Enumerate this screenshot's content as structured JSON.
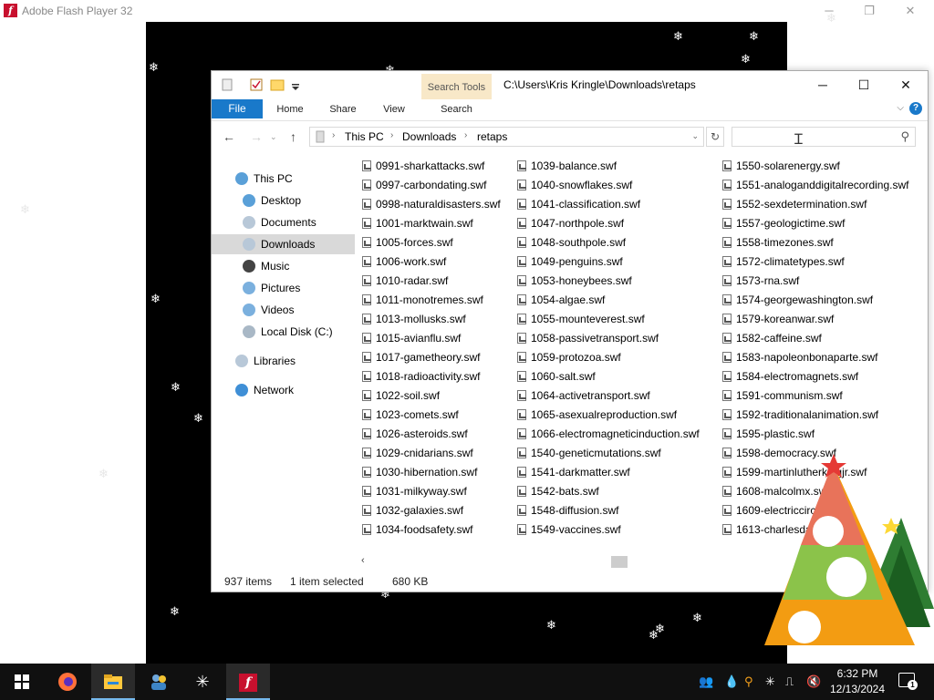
{
  "flash": {
    "title": "Adobe Flash Player 32",
    "logo_letter": "f",
    "controls": {
      "minimize": "─",
      "restore": "❐",
      "close": "✕"
    }
  },
  "explorer": {
    "context_tab": "Search Tools",
    "title": "C:\\Users\\Kris Kringle\\Downloads\\retaps",
    "controls": {
      "minimize": "─",
      "maximize": "☐",
      "close": "✕"
    },
    "tabs": [
      "File",
      "Home",
      "Share",
      "View",
      "Search"
    ],
    "breadcrumb": [
      "This PC",
      "Downloads",
      "retaps"
    ],
    "search": {
      "placeholder": ""
    },
    "nav": [
      {
        "label": "This PC",
        "icon": "pc-icon"
      },
      {
        "label": "Desktop",
        "icon": "desktop-icon"
      },
      {
        "label": "Documents",
        "icon": "documents-icon"
      },
      {
        "label": "Downloads",
        "icon": "downloads-icon",
        "selected": true
      },
      {
        "label": "Music",
        "icon": "music-icon"
      },
      {
        "label": "Pictures",
        "icon": "pictures-icon"
      },
      {
        "label": "Videos",
        "icon": "videos-icon"
      },
      {
        "label": "Local Disk (C:)",
        "icon": "disk-icon"
      },
      {
        "label": "Libraries",
        "icon": "libraries-icon"
      },
      {
        "label": "Network",
        "icon": "network-icon"
      }
    ],
    "files": [
      [
        "0991-sharkattacks.swf",
        "0997-carbondating.swf",
        "0998-naturaldisasters.swf",
        "1001-marktwain.swf",
        "1005-forces.swf",
        "1006-work.swf",
        "1010-radar.swf",
        "1011-monotremes.swf",
        "1013-mollusks.swf",
        "1015-avianflu.swf",
        "1017-gametheory.swf",
        "1018-radioactivity.swf",
        "1022-soil.swf",
        "1023-comets.swf",
        "1026-asteroids.swf",
        "1029-cnidarians.swf",
        "1030-hibernation.swf",
        "1031-milkyway.swf",
        "1032-galaxies.swf",
        "1034-foodsafety.swf"
      ],
      [
        "1039-balance.swf",
        "1040-snowflakes.swf",
        "1041-classification.swf",
        "1047-northpole.swf",
        "1048-southpole.swf",
        "1049-penguins.swf",
        "1053-honeybees.swf",
        "1054-algae.swf",
        "1055-mounteverest.swf",
        "1058-passivetransport.swf",
        "1059-protozoa.swf",
        "1060-salt.swf",
        "1064-activetransport.swf",
        "1065-asexualreproduction.swf",
        "1066-electromagneticinduction.swf",
        "1540-geneticmutations.swf",
        "1541-darkmatter.swf",
        "1542-bats.swf",
        "1548-diffusion.swf",
        "1549-vaccines.swf"
      ],
      [
        "1550-solarenergy.swf",
        "1551-analoganddigitalrecording.swf",
        "1552-sexdetermination.swf",
        "1557-geologictime.swf",
        "1558-timezones.swf",
        "1572-climatetypes.swf",
        "1573-rna.swf",
        "1574-georgewashington.swf",
        "1579-koreanwar.swf",
        "1582-caffeine.swf",
        "1583-napoleonbonaparte.swf",
        "1584-electromagnets.swf",
        "1591-communism.swf",
        "1592-traditionalanimation.swf",
        "1595-plastic.swf",
        "1598-democracy.swf",
        "1599-martinlutherkingjr.swf",
        "1608-malcolmx.swf",
        "1609-electriccircuits.swf",
        "1613-charlesdarwin.swf"
      ]
    ],
    "status": {
      "count": "937 items",
      "selected": "1 item selected",
      "size": "680 KB"
    }
  },
  "taskbar": {
    "items": [
      "start-icon",
      "firefox-icon",
      "file-explorer-icon",
      "people-icon",
      "snowflake-app-icon",
      "flash-player-icon"
    ],
    "clock": {
      "time": "6:32 PM",
      "date": "12/13/2024"
    },
    "notification_count": "1"
  }
}
